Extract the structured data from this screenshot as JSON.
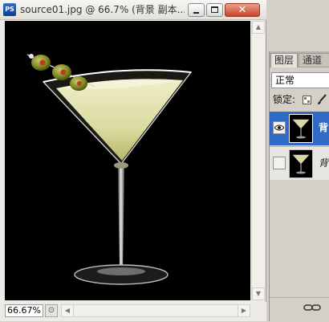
{
  "window": {
    "app_icon": "PS",
    "title": "source01.jpg @ 66.7% (背景 副本...",
    "close_glyph": "✕"
  },
  "status": {
    "zoom": "66.67%"
  },
  "layers_panel": {
    "tabs": [
      {
        "label": "图层"
      },
      {
        "label": "通道"
      }
    ],
    "blend_mode": "正常",
    "lock_label": "锁定:",
    "layers": [
      {
        "name": "背",
        "visible": true,
        "selected": true
      },
      {
        "name": "背",
        "visible": false,
        "selected": false
      }
    ]
  },
  "icons": {
    "app": "photoshop-icon",
    "visibility": "eye-icon",
    "brush": "brush-icon",
    "link": "link-icon",
    "navigate": "navigator-icon"
  },
  "colors": {
    "selected_layer": "#3169c6",
    "close_button": "#c8452b",
    "canvas": "#000000"
  }
}
